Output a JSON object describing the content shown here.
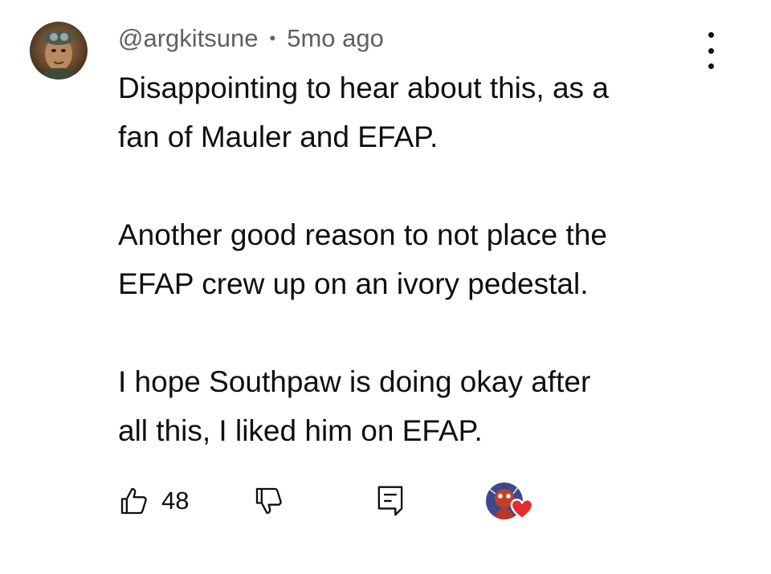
{
  "comment": {
    "author": "@argkitsune",
    "separator": "•",
    "time": "5mo ago",
    "paragraphs": [
      [
        "Disappointing to hear about this, as a",
        "fan of Mauler and EFAP."
      ],
      [
        "Another good reason to not place the",
        "EFAP crew up on an ivory pedestal."
      ],
      [
        "I hope Southpaw is doing okay after",
        "all this, I liked him on EFAP."
      ]
    ]
  },
  "actions": {
    "like_count": "48"
  },
  "icons": {
    "more": "more-vertical-icon",
    "like": "thumb-up-icon",
    "dislike": "thumb-down-icon",
    "reply": "reply-comment-icon",
    "heart": "heart-icon"
  },
  "colors": {
    "text": "#0f0f0f",
    "meta": "#606060",
    "heart": "#e52b2b"
  }
}
